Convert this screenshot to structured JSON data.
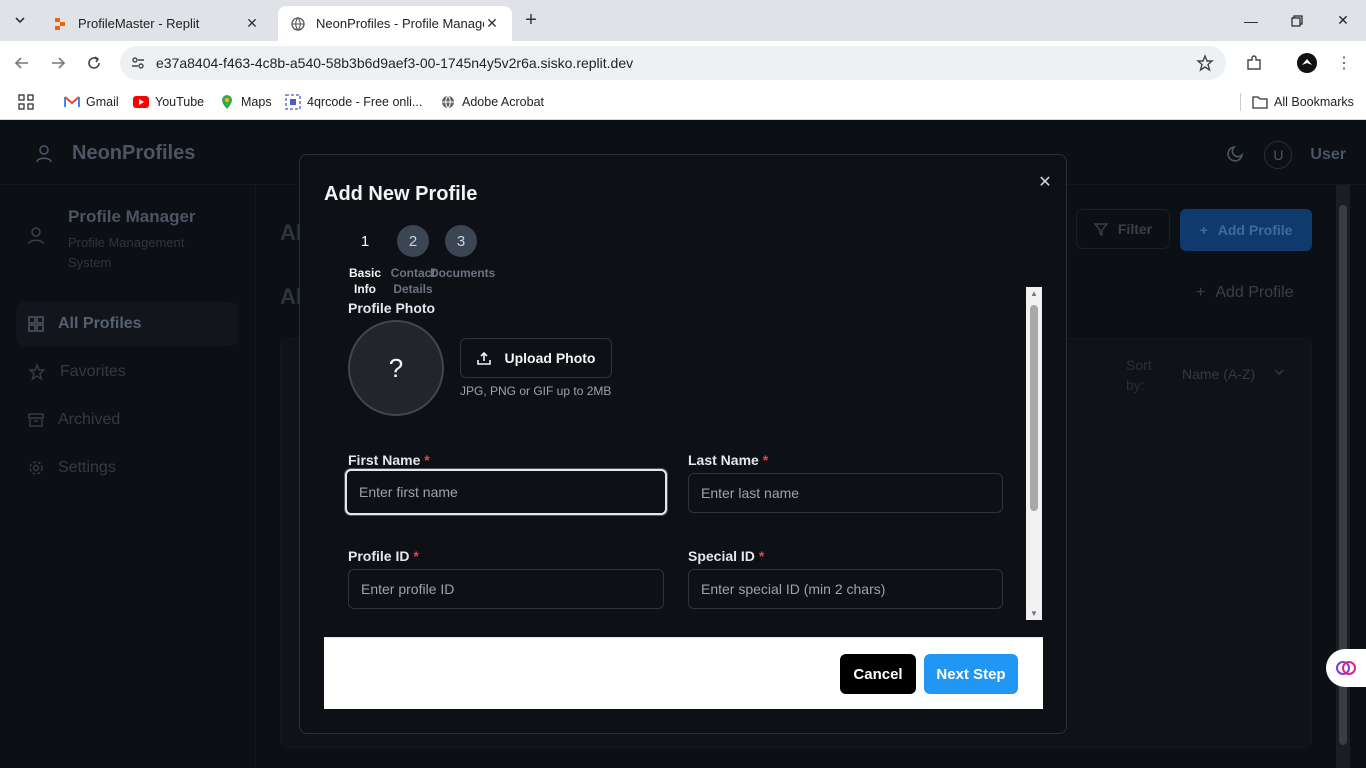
{
  "browser": {
    "tabs": [
      {
        "title": "ProfileMaster - Replit",
        "active": false
      },
      {
        "title": "NeonProfiles - Profile Manager",
        "active": true
      }
    ],
    "url": "e37a8404-f463-4c8b-a540-58b3b6d9aef3-00-1745n4y5v2r6a.sisko.replit.dev",
    "bookmarks": [
      {
        "label": "Gmail"
      },
      {
        "label": "YouTube"
      },
      {
        "label": "Maps"
      },
      {
        "label": "4qrcode - Free onli..."
      },
      {
        "label": "Adobe Acrobat"
      }
    ],
    "all_bookmarks": "All Bookmarks"
  },
  "app": {
    "brand": "NeonProfiles",
    "user_initial": "U",
    "user_name": "User",
    "sidebar": {
      "title": "Profile Manager",
      "subtitle": "Profile Management System",
      "items": [
        {
          "label": "All Profiles",
          "icon": "grid-icon",
          "active": true
        },
        {
          "label": "Favorites",
          "icon": "star-icon",
          "active": false
        },
        {
          "label": "Archived",
          "icon": "archive-icon",
          "active": false
        },
        {
          "label": "Settings",
          "icon": "gear-icon",
          "active": false
        }
      ]
    },
    "main": {
      "title_partial_1": "Al",
      "title_partial_2": "Al",
      "filter_label": "Filter",
      "add_profile_label": "Add Profile",
      "add_profile_link": "Add Profile",
      "sort_by_label": "Sort by:",
      "sort_value": "Name (A-Z)"
    }
  },
  "modal": {
    "title": "Add New Profile",
    "steps": [
      {
        "number": "1",
        "label": "Basic Info",
        "state": "current"
      },
      {
        "number": "2",
        "label": "Contact Details",
        "state": "pending"
      },
      {
        "number": "3",
        "label": "Documents",
        "state": "pending"
      }
    ],
    "photo": {
      "section_label": "Profile Photo",
      "placeholder_glyph": "?",
      "upload_label": "Upload Photo",
      "hint": "JPG, PNG or GIF up to 2MB"
    },
    "fields": {
      "first_name": {
        "label": "First Name",
        "required": "*",
        "placeholder": "Enter first name",
        "value": ""
      },
      "last_name": {
        "label": "Last Name",
        "required": "*",
        "placeholder": "Enter last name",
        "value": ""
      },
      "profile_id": {
        "label": "Profile ID",
        "required": "*",
        "placeholder": "Enter profile ID",
        "value": ""
      },
      "special_id": {
        "label": "Special ID",
        "required": "*",
        "placeholder": "Enter special ID (min 2 chars)",
        "value": ""
      }
    },
    "cancel_label": "Cancel",
    "next_label": "Next Step"
  },
  "colors": {
    "accent": "#2196f3",
    "required": "#ef4444",
    "modal_bg": "#0d1014"
  }
}
